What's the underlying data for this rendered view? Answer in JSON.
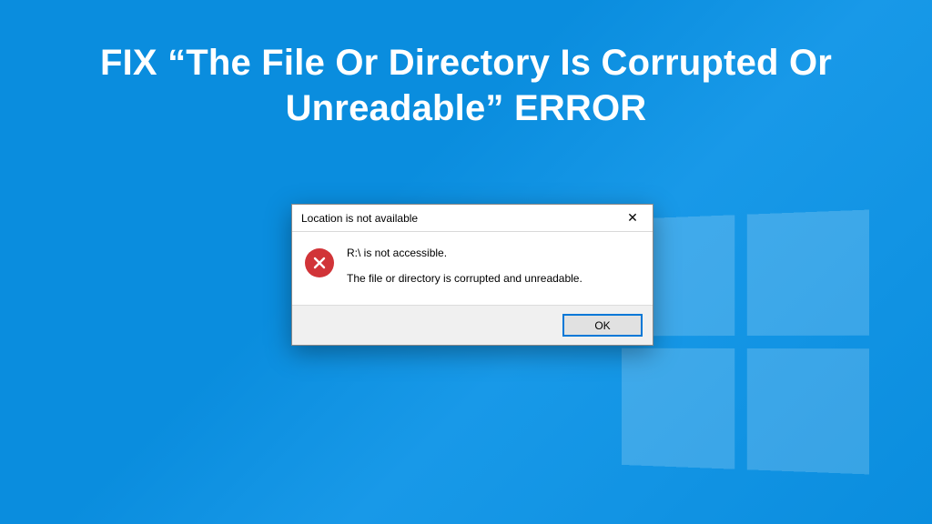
{
  "headline": "FIX “The File Or Directory Is Corrupted Or Unreadable” ERROR",
  "dialog": {
    "title": "Location is not available",
    "message_line1": "R:\\ is not accessible.",
    "message_line2": "The file or directory is corrupted and unreadable.",
    "ok_label": "OK",
    "close_glyph": "✕"
  }
}
